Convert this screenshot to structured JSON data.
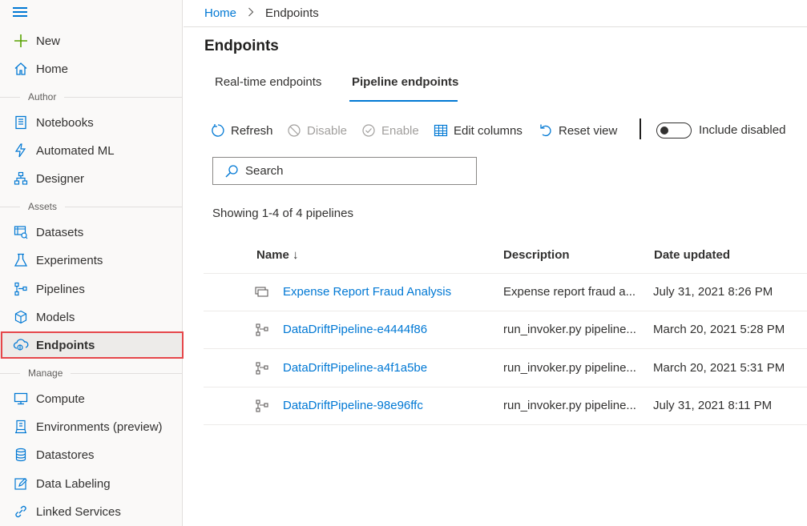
{
  "sidebar": {
    "items": [
      {
        "label": "New",
        "icon": "plus-icon"
      },
      {
        "label": "Home",
        "icon": "home-icon"
      },
      {
        "label": "Notebooks",
        "icon": "notebook-icon"
      },
      {
        "label": "Automated ML",
        "icon": "automl-icon"
      },
      {
        "label": "Designer",
        "icon": "designer-icon"
      },
      {
        "label": "Datasets",
        "icon": "dataset-icon"
      },
      {
        "label": "Experiments",
        "icon": "flask-icon"
      },
      {
        "label": "Pipelines",
        "icon": "pipeline-icon"
      },
      {
        "label": "Models",
        "icon": "cube-icon"
      },
      {
        "label": "Endpoints",
        "icon": "cloud-endpoint-icon"
      },
      {
        "label": "Compute",
        "icon": "monitor-icon"
      },
      {
        "label": "Environments (preview)",
        "icon": "environment-icon"
      },
      {
        "label": "Datastores",
        "icon": "database-icon"
      },
      {
        "label": "Data Labeling",
        "icon": "edit-icon"
      },
      {
        "label": "Linked Services",
        "icon": "link-icon"
      }
    ],
    "sections": {
      "author": "Author",
      "assets": "Assets",
      "manage": "Manage"
    }
  },
  "breadcrumb": {
    "home": "Home",
    "current": "Endpoints"
  },
  "page_title": "Endpoints",
  "tabs": [
    {
      "label": "Real-time endpoints"
    },
    {
      "label": "Pipeline endpoints"
    }
  ],
  "toolbar": {
    "refresh": "Refresh",
    "disable": "Disable",
    "enable": "Enable",
    "edit_columns": "Edit columns",
    "reset_view": "Reset view",
    "include_disabled": "Include disabled"
  },
  "search": {
    "placeholder": "Search"
  },
  "showing": "Showing 1-4 of 4 pipelines",
  "table": {
    "columns": {
      "name": "Name ↓",
      "description": "Description",
      "date": "Date updated"
    },
    "rows": [
      {
        "name": "Expense Report Fraud Analysis",
        "description": "Expense report fraud a...",
        "date": "July 31, 2021 8:26 PM"
      },
      {
        "name": "DataDriftPipeline-e4444f86",
        "description": "run_invoker.py pipeline...",
        "date": "March 20, 2021 5:28 PM"
      },
      {
        "name": "DataDriftPipeline-a4f1a5be",
        "description": "run_invoker.py pipeline...",
        "date": "March 20, 2021 5:31 PM"
      },
      {
        "name": "DataDriftPipeline-98e96ffc",
        "description": "run_invoker.py pipeline...",
        "date": "July 31, 2021 8:11 PM"
      }
    ]
  },
  "colors": {
    "accent": "#0078d4",
    "highlight_border": "#e6464a",
    "new_plus": "#57a300"
  }
}
